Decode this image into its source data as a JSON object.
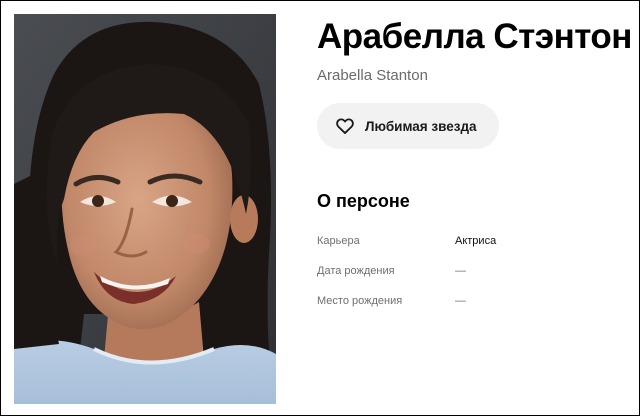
{
  "person": {
    "name": "Арабелла Стэнтон",
    "original_name": "Arabella Stanton",
    "favorite_button_label": "Любимая звезда",
    "favorite_icon": "heart-icon",
    "photo_alt": "Arabella Stanton"
  },
  "about": {
    "title": "О персоне",
    "rows": [
      {
        "key": "Карьера",
        "value": "Актриса"
      },
      {
        "key": "Дата рождения",
        "value": "—"
      },
      {
        "key": "Место рождения",
        "value": "—"
      }
    ]
  }
}
